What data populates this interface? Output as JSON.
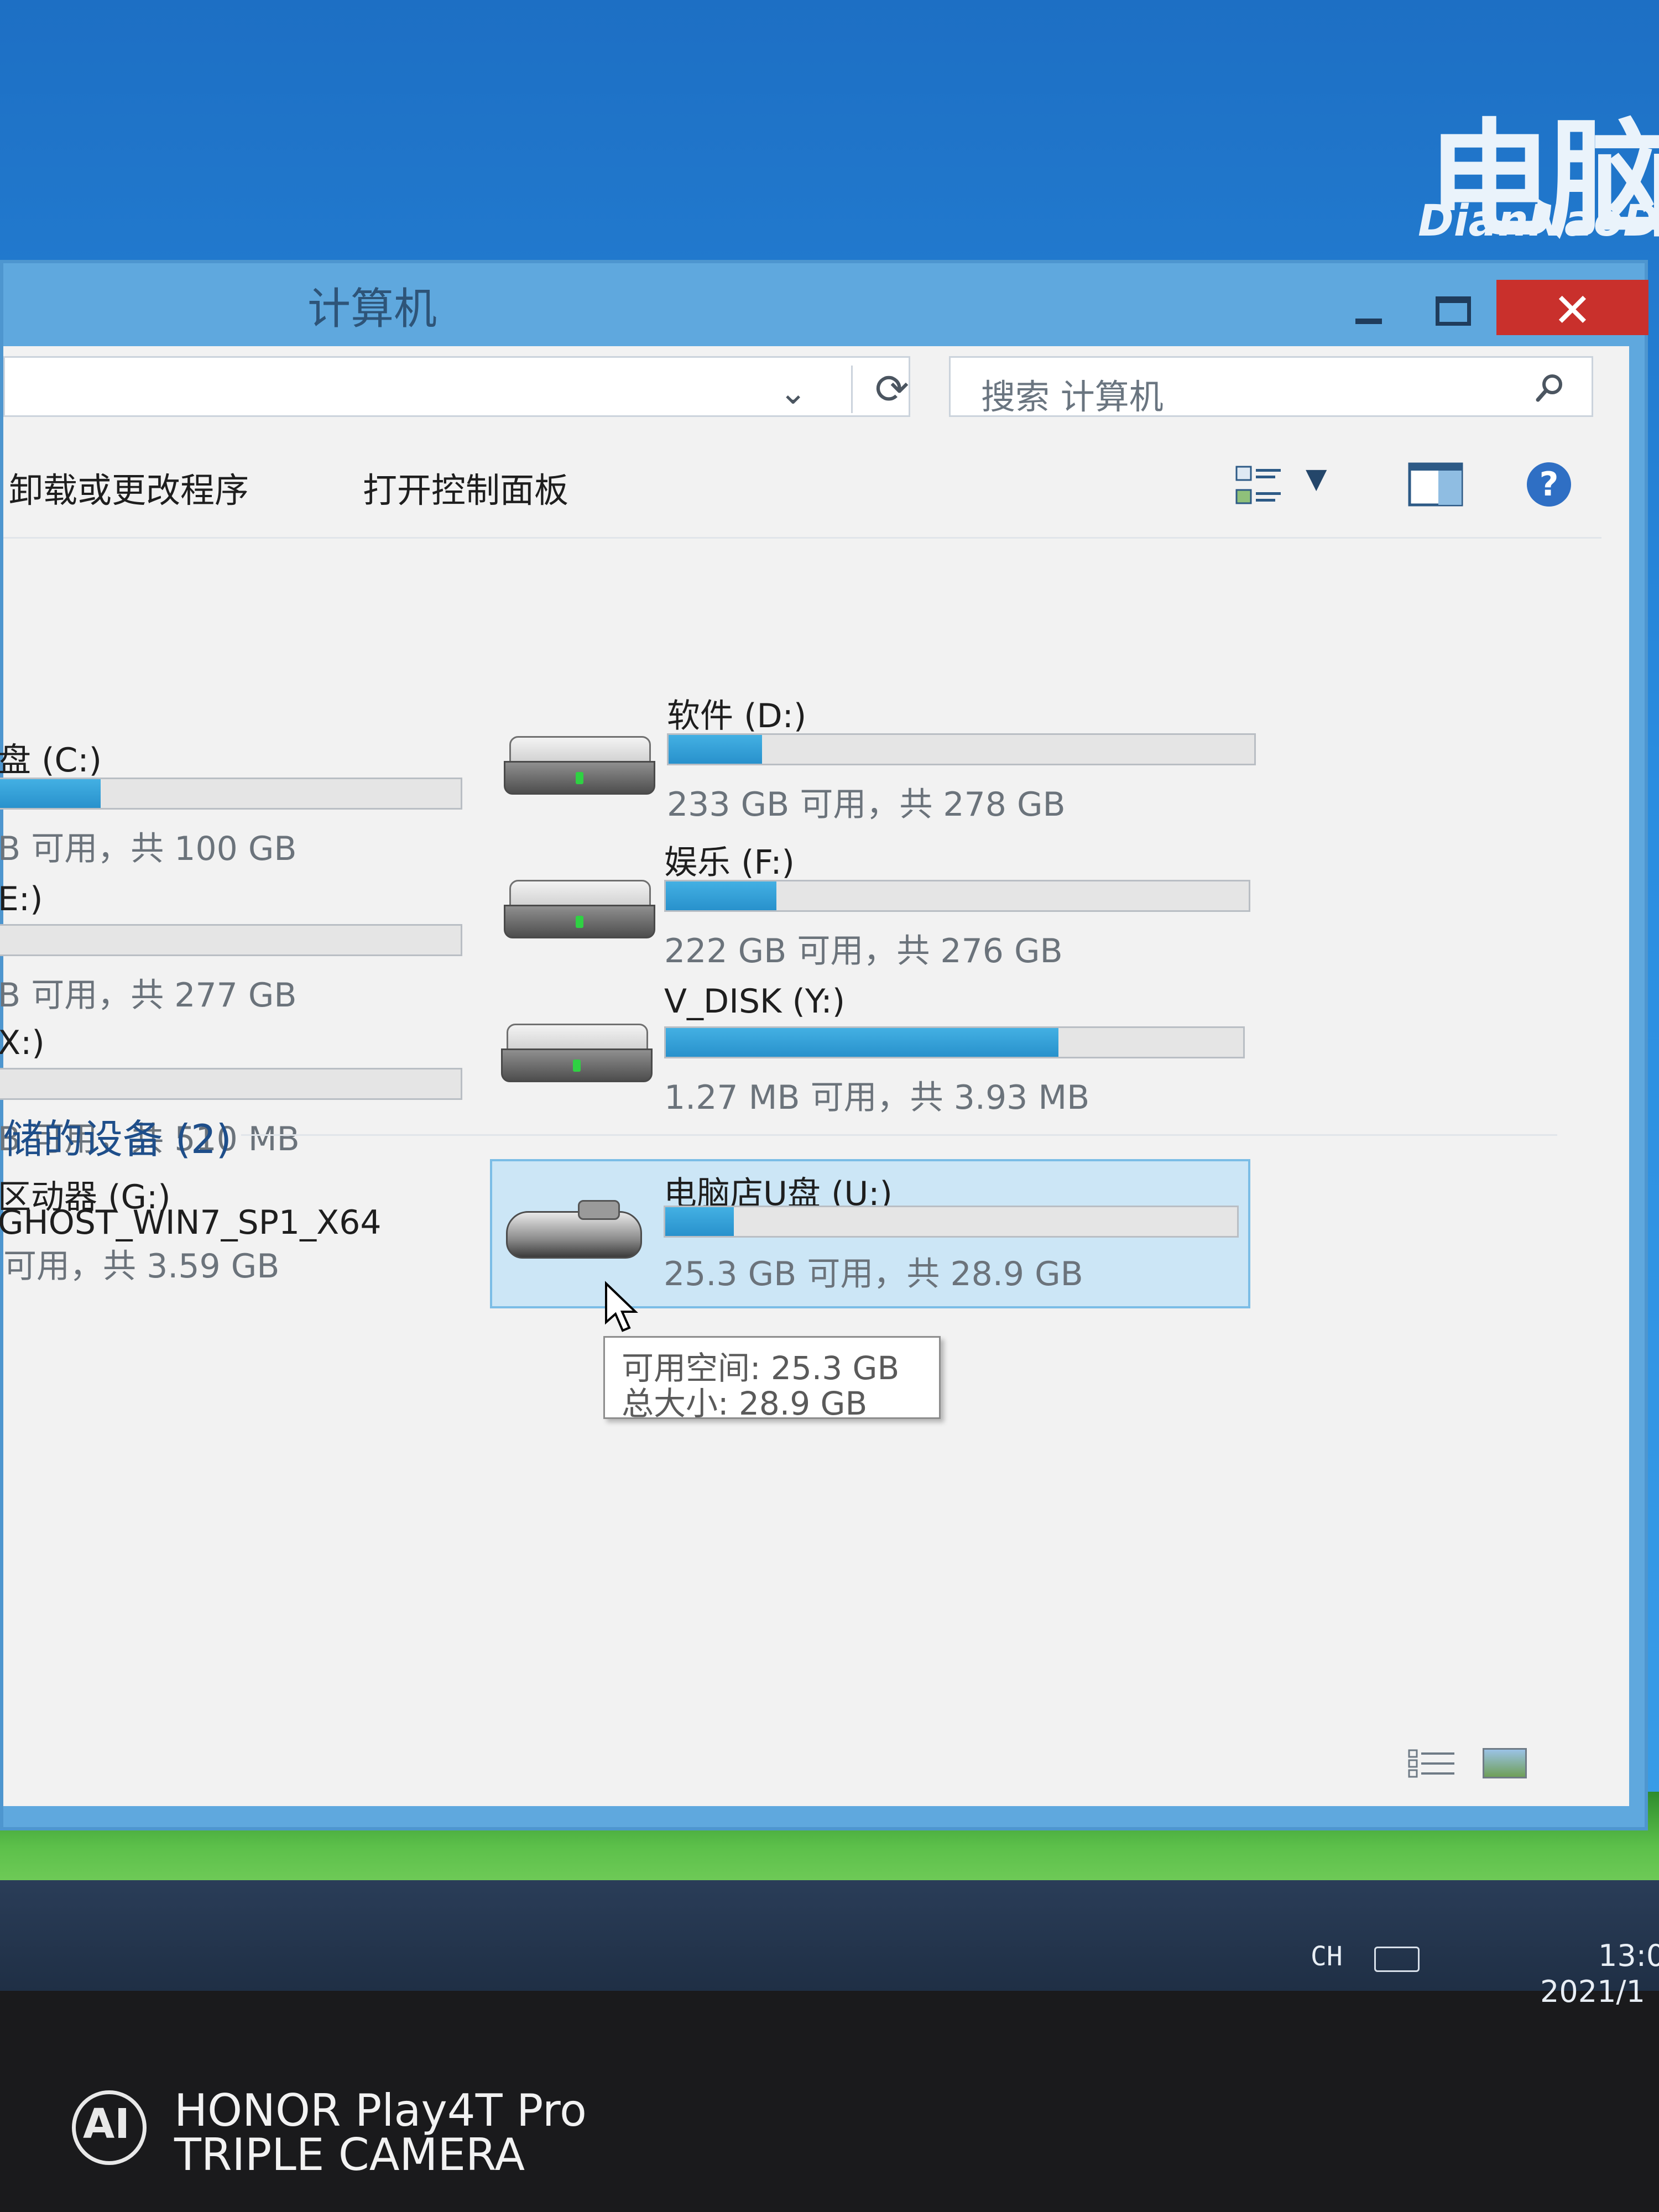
{
  "wallpaper": {
    "brand_cn": "电脑",
    "brand_en": "DianNaoD"
  },
  "window": {
    "title": "计算机",
    "close_label": "✕"
  },
  "search": {
    "placeholder": "搜索 计算机"
  },
  "commands": {
    "uninstall": "卸载或更改程序",
    "control_panel": "打开控制面板"
  },
  "drives_left": [
    {
      "name": "盘 (C:)",
      "free_text": "B 可用，共 100 GB",
      "used_fraction": 0.22
    },
    {
      "name": "E:)",
      "free_text": "B 可用，共 277 GB",
      "used_fraction": 0.0
    },
    {
      "name": "X:)",
      "free_text": "B 可用，共 510 MB",
      "used_fraction": 0.0
    }
  ],
  "drives_right": [
    {
      "name": "软件 (D:)",
      "free_text": "233 GB 可用，共 278 GB",
      "used_fraction": 0.16
    },
    {
      "name": "娱乐 (F:)",
      "free_text": "222 GB 可用，共 276 GB",
      "used_fraction": 0.19
    },
    {
      "name": "V_DISK (Y:)",
      "free_text": "1.27 MB 可用，共 3.93 MB",
      "used_fraction": 0.68
    }
  ],
  "removable_section": {
    "header": "储的设备 (2)"
  },
  "optical_drive": {
    "name": "区动器 (G:)",
    "label": "GHOST_WIN7_SP1_X64",
    "free_text": "可用，共 3.59 GB"
  },
  "usb_drive": {
    "name": "电脑店U盘 (U:)",
    "free_text": "25.3 GB 可用，共 28.9 GB",
    "used_fraction": 0.12
  },
  "tooltip": {
    "line1": "可用空间: 25.3 GB",
    "line2": "总大小: 28.9 GB"
  },
  "taskbar": {
    "ime": "CH",
    "time": "13:0",
    "date": "2021/1"
  },
  "camera_watermark": {
    "logo": "AI",
    "line1": "HONOR Play4T Pro",
    "line2": "TRIPLE CAMERA"
  },
  "colors": {
    "bar_fill": "#2891cc",
    "close_button": "#c9302c",
    "section_header": "#1e4e8a"
  }
}
